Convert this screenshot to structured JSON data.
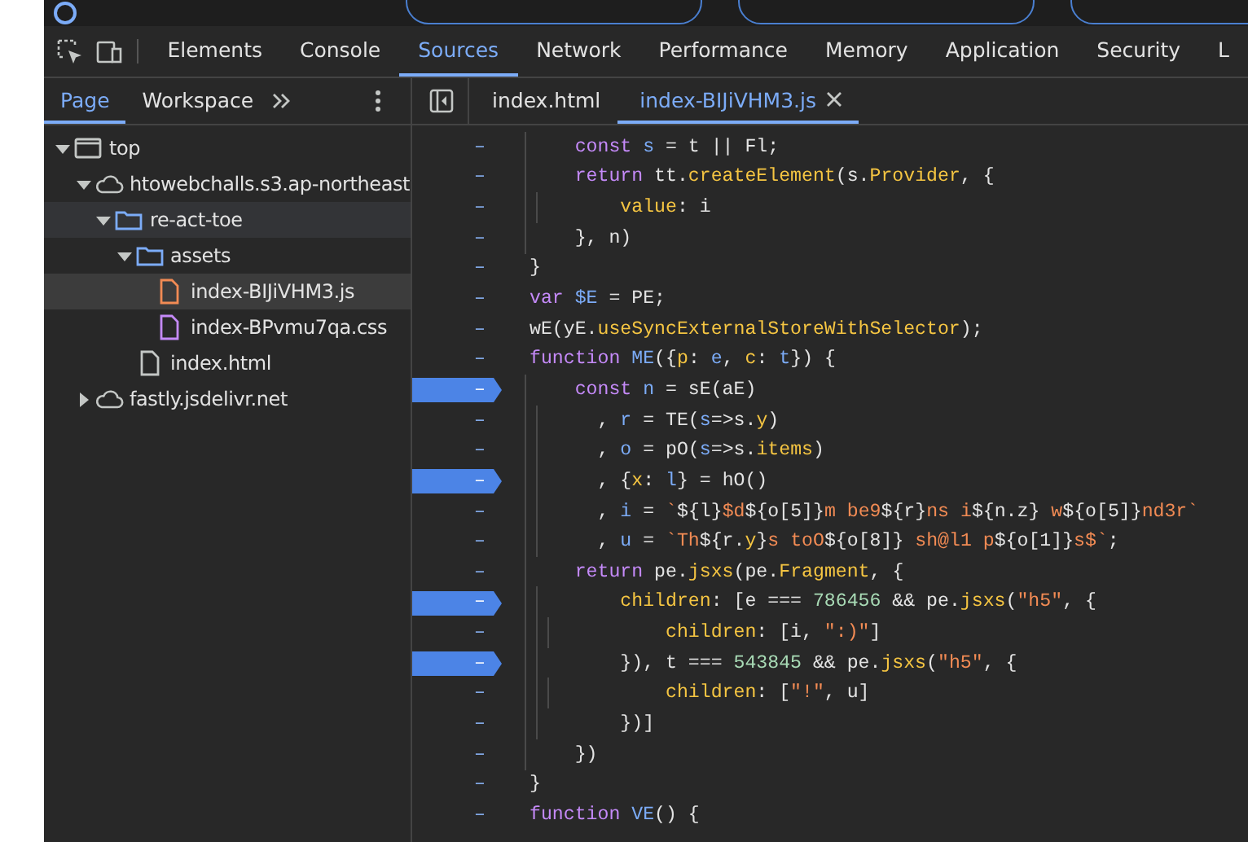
{
  "toolbar": {
    "tabs": [
      {
        "label": "Elements",
        "selected": false
      },
      {
        "label": "Console",
        "selected": false
      },
      {
        "label": "Sources",
        "selected": true
      },
      {
        "label": "Network",
        "selected": false
      },
      {
        "label": "Performance",
        "selected": false
      },
      {
        "label": "Memory",
        "selected": false
      },
      {
        "label": "Application",
        "selected": false
      },
      {
        "label": "Security",
        "selected": false
      },
      {
        "label": "L",
        "selected": false
      }
    ]
  },
  "navigator": {
    "tabs": [
      {
        "label": "Page",
        "selected": true
      },
      {
        "label": "Workspace",
        "selected": false
      }
    ],
    "tree": [
      {
        "kind": "frame",
        "label": "top",
        "expanded": true,
        "selected": false,
        "hovered": false,
        "children": [
          {
            "kind": "cloud",
            "label": "htowebchalls.s3.ap-northeast",
            "expanded": true,
            "selected": false,
            "hovered": false,
            "children": [
              {
                "kind": "folder",
                "label": "re-act-toe",
                "expanded": true,
                "selected": false,
                "hovered": true,
                "children": [
                  {
                    "kind": "folder",
                    "label": "assets",
                    "expanded": true,
                    "selected": false,
                    "hovered": false,
                    "children": [
                      {
                        "kind": "js",
                        "label": "index-BIJiVHM3.js",
                        "selected": true,
                        "hovered": false
                      },
                      {
                        "kind": "css",
                        "label": "index-BPvmu7qa.css",
                        "selected": false,
                        "hovered": false
                      }
                    ]
                  },
                  {
                    "kind": "html",
                    "label": "index.html",
                    "selected": false,
                    "hovered": false
                  }
                ]
              }
            ]
          },
          {
            "kind": "cloud",
            "label": "fastly.jsdelivr.net",
            "expanded": false,
            "selected": false,
            "hovered": false
          }
        ]
      }
    ]
  },
  "editor": {
    "tabs": [
      {
        "label": "index.html",
        "selected": false,
        "closable": false
      },
      {
        "label": "index-BIJiVHM3.js",
        "selected": true,
        "closable": true
      }
    ],
    "lines": [
      {
        "gutter": "–",
        "breakpoint": false,
        "tokens": [
          {
            "text": "    const ",
            "kind": "kw"
          },
          {
            "text": "s",
            "kind": "var"
          },
          {
            "text": " = t || Fl;",
            "kind": "plain"
          }
        ]
      },
      {
        "gutter": "–",
        "breakpoint": false,
        "tokens": [
          {
            "text": "    return",
            "kind": "kw"
          },
          {
            "text": " tt.",
            "kind": "plain"
          },
          {
            "text": "createElement",
            "kind": "prop"
          },
          {
            "text": "(s.",
            "kind": "plain"
          },
          {
            "text": "Provider",
            "kind": "prop"
          },
          {
            "text": ", {",
            "kind": "plain"
          }
        ]
      },
      {
        "gutter": "–",
        "breakpoint": false,
        "tokens": [
          {
            "text": "        value",
            "kind": "prop"
          },
          {
            "text": ": i",
            "kind": "plain"
          }
        ]
      },
      {
        "gutter": "–",
        "breakpoint": false,
        "tokens": [
          {
            "text": "    }, n)",
            "kind": "plain"
          }
        ]
      },
      {
        "gutter": "–",
        "breakpoint": false,
        "tokens": [
          {
            "text": "}",
            "kind": "plain"
          }
        ]
      },
      {
        "gutter": "–",
        "breakpoint": false,
        "tokens": [
          {
            "text": "var ",
            "kind": "kw"
          },
          {
            "text": "$E",
            "kind": "var"
          },
          {
            "text": " = PE;",
            "kind": "plain"
          }
        ]
      },
      {
        "gutter": "–",
        "breakpoint": false,
        "tokens": [
          {
            "text": "wE(yE.",
            "kind": "plain"
          },
          {
            "text": "useSyncExternalStoreWithSelector",
            "kind": "prop"
          },
          {
            "text": ");",
            "kind": "plain"
          }
        ]
      },
      {
        "gutter": "–",
        "breakpoint": false,
        "tokens": [
          {
            "text": "function ",
            "kind": "kw"
          },
          {
            "text": "ME",
            "kind": "var"
          },
          {
            "text": "({",
            "kind": "plain"
          },
          {
            "text": "p",
            "kind": "prop"
          },
          {
            "text": ": ",
            "kind": "plain"
          },
          {
            "text": "e",
            "kind": "var"
          },
          {
            "text": ", ",
            "kind": "plain"
          },
          {
            "text": "c",
            "kind": "prop"
          },
          {
            "text": ": ",
            "kind": "plain"
          },
          {
            "text": "t",
            "kind": "var"
          },
          {
            "text": "}) {",
            "kind": "plain"
          }
        ]
      },
      {
        "gutter": "–",
        "breakpoint": true,
        "tokens": [
          {
            "text": "    const ",
            "kind": "kw"
          },
          {
            "text": "n",
            "kind": "var"
          },
          {
            "text": " = sE(aE)",
            "kind": "plain"
          }
        ]
      },
      {
        "gutter": "–",
        "breakpoint": false,
        "tokens": [
          {
            "text": "      , ",
            "kind": "plain"
          },
          {
            "text": "r",
            "kind": "var"
          },
          {
            "text": " = TE(",
            "kind": "plain"
          },
          {
            "text": "s",
            "kind": "var"
          },
          {
            "text": "=>s.",
            "kind": "plain"
          },
          {
            "text": "y",
            "kind": "prop"
          },
          {
            "text": ")",
            "kind": "plain"
          }
        ]
      },
      {
        "gutter": "–",
        "breakpoint": false,
        "tokens": [
          {
            "text": "      , ",
            "kind": "plain"
          },
          {
            "text": "o",
            "kind": "var"
          },
          {
            "text": " = pO(",
            "kind": "plain"
          },
          {
            "text": "s",
            "kind": "var"
          },
          {
            "text": "=>s.",
            "kind": "plain"
          },
          {
            "text": "items",
            "kind": "prop"
          },
          {
            "text": ")",
            "kind": "plain"
          }
        ]
      },
      {
        "gutter": "–",
        "breakpoint": true,
        "tokens": [
          {
            "text": "      , {",
            "kind": "plain"
          },
          {
            "text": "x",
            "kind": "prop"
          },
          {
            "text": ": ",
            "kind": "plain"
          },
          {
            "text": "l",
            "kind": "var"
          },
          {
            "text": "} = hO()",
            "kind": "plain"
          }
        ]
      },
      {
        "gutter": "–",
        "breakpoint": false,
        "tokens": [
          {
            "text": "      , ",
            "kind": "plain"
          },
          {
            "text": "i",
            "kind": "var"
          },
          {
            "text": " = ",
            "kind": "plain"
          },
          {
            "text": "`",
            "kind": "str"
          },
          {
            "text": "${l}",
            "kind": "plain"
          },
          {
            "text": "$d",
            "kind": "str"
          },
          {
            "text": "${o[5]}",
            "kind": "plain"
          },
          {
            "text": "m be9",
            "kind": "str"
          },
          {
            "text": "${r}",
            "kind": "plain"
          },
          {
            "text": "ns i",
            "kind": "str"
          },
          {
            "text": "${n.z}",
            "kind": "plain"
          },
          {
            "text": " w",
            "kind": "str"
          },
          {
            "text": "${o[5]}",
            "kind": "plain"
          },
          {
            "text": "nd3r`",
            "kind": "str"
          }
        ]
      },
      {
        "gutter": "–",
        "breakpoint": false,
        "tokens": [
          {
            "text": "      , ",
            "kind": "plain"
          },
          {
            "text": "u",
            "kind": "var"
          },
          {
            "text": " = ",
            "kind": "plain"
          },
          {
            "text": "`Th",
            "kind": "str"
          },
          {
            "text": "${r.",
            "kind": "plain"
          },
          {
            "text": "y",
            "kind": "prop"
          },
          {
            "text": "}",
            "kind": "plain"
          },
          {
            "text": "s toO",
            "kind": "str"
          },
          {
            "text": "${o[8]}",
            "kind": "plain"
          },
          {
            "text": " sh@l1 p",
            "kind": "str"
          },
          {
            "text": "${o[1]}",
            "kind": "plain"
          },
          {
            "text": "s$`",
            "kind": "str"
          },
          {
            "text": ";",
            "kind": "plain"
          }
        ]
      },
      {
        "gutter": "–",
        "breakpoint": false,
        "tokens": [
          {
            "text": "    return",
            "kind": "kw"
          },
          {
            "text": " pe.",
            "kind": "plain"
          },
          {
            "text": "jsxs",
            "kind": "prop"
          },
          {
            "text": "(pe.",
            "kind": "plain"
          },
          {
            "text": "Fragment",
            "kind": "prop"
          },
          {
            "text": ", {",
            "kind": "plain"
          }
        ]
      },
      {
        "gutter": "–",
        "breakpoint": true,
        "tokens": [
          {
            "text": "        children",
            "kind": "prop"
          },
          {
            "text": ": [e === ",
            "kind": "plain"
          },
          {
            "text": "786456",
            "kind": "num"
          },
          {
            "text": " && pe.",
            "kind": "plain"
          },
          {
            "text": "jsxs",
            "kind": "prop"
          },
          {
            "text": "(",
            "kind": "plain"
          },
          {
            "text": "\"h5\"",
            "kind": "str"
          },
          {
            "text": ", {",
            "kind": "plain"
          }
        ]
      },
      {
        "gutter": "–",
        "breakpoint": false,
        "tokens": [
          {
            "text": "            children",
            "kind": "prop"
          },
          {
            "text": ": [i, ",
            "kind": "plain"
          },
          {
            "text": "\":)\"",
            "kind": "str"
          },
          {
            "text": "]",
            "kind": "plain"
          }
        ]
      },
      {
        "gutter": "–",
        "breakpoint": true,
        "tokens": [
          {
            "text": "        }), t === ",
            "kind": "plain"
          },
          {
            "text": "543845",
            "kind": "num"
          },
          {
            "text": " && pe.",
            "kind": "plain"
          },
          {
            "text": "jsxs",
            "kind": "prop"
          },
          {
            "text": "(",
            "kind": "plain"
          },
          {
            "text": "\"h5\"",
            "kind": "str"
          },
          {
            "text": ", {",
            "kind": "plain"
          }
        ]
      },
      {
        "gutter": "–",
        "breakpoint": false,
        "tokens": [
          {
            "text": "            children",
            "kind": "prop"
          },
          {
            "text": ": [",
            "kind": "plain"
          },
          {
            "text": "\"!\"",
            "kind": "str"
          },
          {
            "text": ", u]",
            "kind": "plain"
          }
        ]
      },
      {
        "gutter": "–",
        "breakpoint": false,
        "tokens": [
          {
            "text": "        })]",
            "kind": "plain"
          }
        ]
      },
      {
        "gutter": "–",
        "breakpoint": false,
        "tokens": [
          {
            "text": "    })",
            "kind": "plain"
          }
        ]
      },
      {
        "gutter": "–",
        "breakpoint": false,
        "tokens": [
          {
            "text": "}",
            "kind": "plain"
          }
        ]
      },
      {
        "gutter": "–",
        "breakpoint": false,
        "tokens": [
          {
            "text": "function ",
            "kind": "kw"
          },
          {
            "text": "VE",
            "kind": "var"
          },
          {
            "text": "() {",
            "kind": "plain"
          }
        ]
      }
    ]
  }
}
